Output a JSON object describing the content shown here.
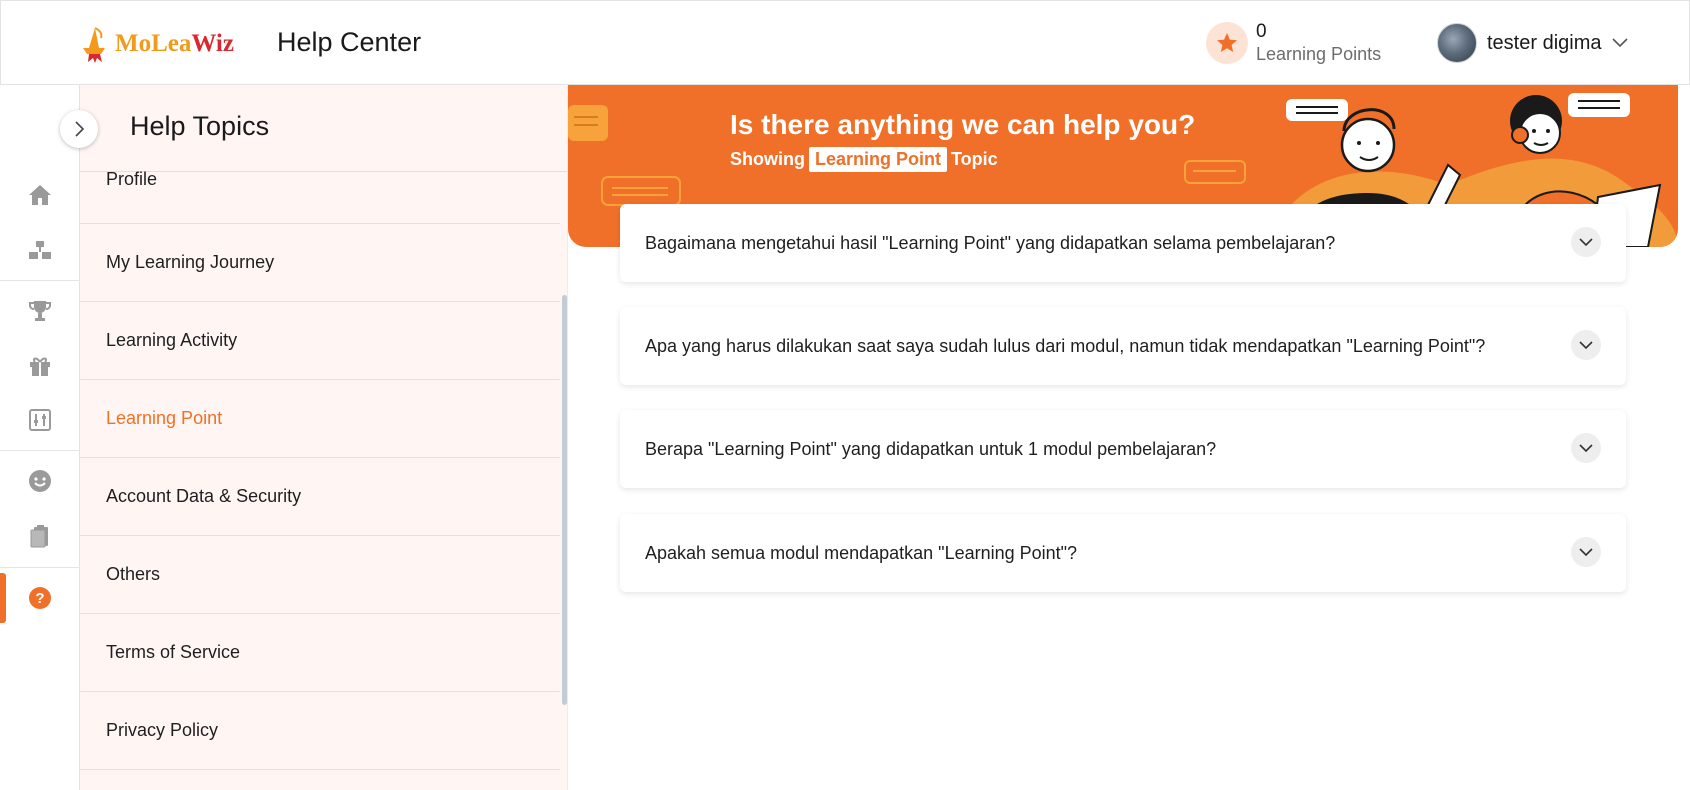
{
  "header": {
    "logo_text_a": "MoLea",
    "logo_text_b": "Wiz",
    "title": "Help Center",
    "points_value": "0",
    "points_label": "Learning Points",
    "user_name": "tester digima"
  },
  "rail": {
    "icons": [
      "home-icon",
      "hierarchy-icon",
      "trophy-icon",
      "gift-icon",
      "sliders-icon",
      "smiley-icon",
      "clipboard-icon",
      "help-icon"
    ],
    "active": "help-icon",
    "accent": "#f07029"
  },
  "topics": {
    "title": "Help Topics",
    "items": [
      {
        "label": "Profile"
      },
      {
        "label": "My Learning Journey"
      },
      {
        "label": "Learning Activity"
      },
      {
        "label": "Learning Point"
      },
      {
        "label": "Account Data & Security"
      },
      {
        "label": "Others"
      },
      {
        "label": "Terms of Service"
      },
      {
        "label": "Privacy Policy"
      }
    ],
    "active_label": "Learning Point"
  },
  "banner": {
    "title": "Is there anything we can help you?",
    "showing": "Showing",
    "topic_chip": "Learning Point",
    "topic_suffix": "Topic",
    "background": "#f07029"
  },
  "faqs": [
    {
      "question": "Bagaimana mengetahui hasil \"Learning Point\" yang didapatkan selama pembelajaran?"
    },
    {
      "question": "Apa yang harus dilakukan saat saya sudah lulus dari modul, namun tidak mendapatkan \"Learning Point\"?"
    },
    {
      "question": "Berapa \"Learning Point\" yang didapatkan untuk 1 modul pembelajaran?"
    },
    {
      "question": "Apakah semua modul mendapatkan \"Learning Point\"?"
    }
  ]
}
